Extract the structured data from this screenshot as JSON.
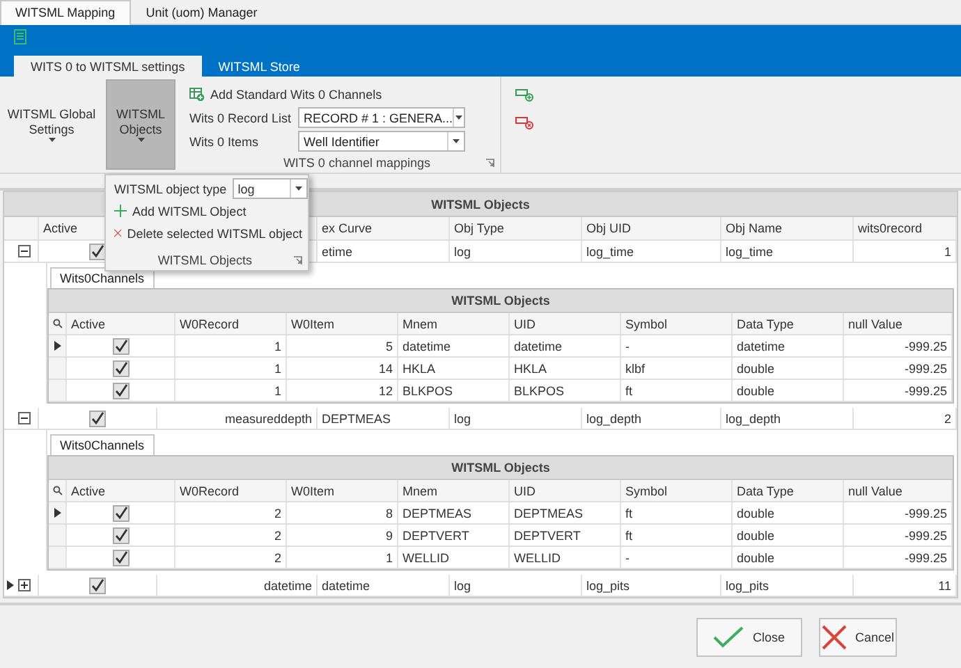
{
  "top_tabs": [
    {
      "label": "WITSML Mapping",
      "selected": true
    },
    {
      "label": "Unit (uom) Manager",
      "selected": false
    }
  ],
  "ribbon": {
    "tabs": [
      {
        "label": "WITS 0 to WITSML settings",
        "selected": true
      },
      {
        "label": "WITSML Store",
        "selected": false
      }
    ],
    "buttons": [
      {
        "label": "WITSML Global Settings",
        "pressed": false
      },
      {
        "label": "WITSML Objects",
        "pressed": true
      }
    ],
    "add_channels": "Add Standard Wits 0 Channels",
    "fields": [
      {
        "label": "Wits 0 Record List",
        "value": "RECORD # 1 : GENERA..."
      },
      {
        "label": "Wits 0 Items",
        "value": "Well Identifier"
      }
    ],
    "group_caption": "WITS 0 channel mappings"
  },
  "popup": {
    "type_label": "WITSML object type",
    "type_value": "log",
    "items": [
      {
        "kind": "add",
        "label": "Add WITSML Object"
      },
      {
        "kind": "delete",
        "label": "Delete selected WITSML object"
      }
    ],
    "caption": "WITSML Objects"
  },
  "grid": {
    "title": "WITSML Objects",
    "columns": [
      "Active",
      "ex Curve",
      "Obj Type",
      "Obj UID",
      "Obj Name",
      "wits0record"
    ],
    "rows": [
      {
        "selected": false,
        "expanded": true,
        "active": true,
        "index_curve": "etime",
        "obj_type": "log",
        "obj_uid": "log_time",
        "obj_name": "log_time",
        "wits0record": "1",
        "detail": {
          "tab": "Wits0Channels",
          "title": "WITSML Objects",
          "columns": [
            "Active",
            "W0Record",
            "W0Item",
            "Mnem",
            "UID",
            "Symbol",
            "Data Type",
            "null Value"
          ],
          "rows": [
            {
              "selected": true,
              "active": true,
              "w0record": "1",
              "w0item": "5",
              "mnem": "datetime",
              "uid": "datetime",
              "symbol": "-",
              "data_type": "datetime",
              "null_value": "-999.25"
            },
            {
              "selected": false,
              "active": true,
              "w0record": "1",
              "w0item": "14",
              "mnem": "HKLA",
              "uid": "HKLA",
              "symbol": "klbf",
              "data_type": "double",
              "null_value": "-999.25"
            },
            {
              "selected": false,
              "active": true,
              "w0record": "1",
              "w0item": "12",
              "mnem": "BLKPOS",
              "uid": "BLKPOS",
              "symbol": "ft",
              "data_type": "double",
              "null_value": "-999.25"
            }
          ]
        }
      },
      {
        "selected": false,
        "expanded": true,
        "active": true,
        "column_2": "measureddepth",
        "index_curve": "DEPTMEAS",
        "obj_type": "log",
        "obj_uid": "log_depth",
        "obj_name": "log_depth",
        "wits0record": "2",
        "detail": {
          "tab": "Wits0Channels",
          "title": "WITSML Objects",
          "columns": [
            "Active",
            "W0Record",
            "W0Item",
            "Mnem",
            "UID",
            "Symbol",
            "Data Type",
            "null Value"
          ],
          "rows": [
            {
              "selected": true,
              "active": true,
              "w0record": "2",
              "w0item": "8",
              "mnem": "DEPTMEAS",
              "uid": "DEPTMEAS",
              "symbol": "ft",
              "data_type": "double",
              "null_value": "-999.25"
            },
            {
              "selected": false,
              "active": true,
              "w0record": "2",
              "w0item": "9",
              "mnem": "DEPTVERT",
              "uid": "DEPTVERT",
              "symbol": "ft",
              "data_type": "double",
              "null_value": "-999.25"
            },
            {
              "selected": false,
              "active": true,
              "w0record": "2",
              "w0item": "1",
              "mnem": "WELLID",
              "uid": "WELLID",
              "symbol": "-",
              "data_type": "double",
              "null_value": "-999.25"
            }
          ]
        }
      },
      {
        "selected": true,
        "expanded": false,
        "active": true,
        "column_2": "datetime",
        "index_curve": "datetime",
        "obj_type": "log",
        "obj_uid": "log_pits",
        "obj_name": "log_pits",
        "wits0record": "11"
      }
    ]
  },
  "buttons": [
    {
      "kind": "ok",
      "label": "Close"
    },
    {
      "kind": "cancel",
      "label": "Cancel"
    }
  ]
}
